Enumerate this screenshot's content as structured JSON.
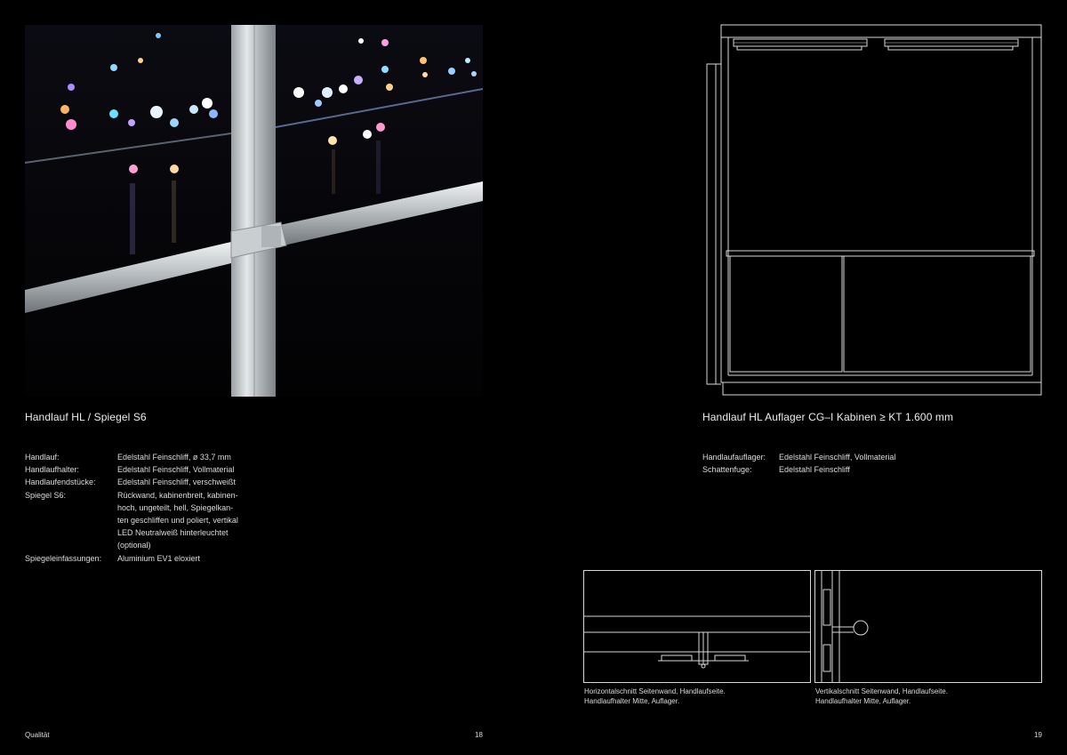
{
  "left_page": {
    "photo_alt": "Handlauf HL / Spiegel S6",
    "title": "Handlauf HL / Spiegel S6",
    "specs": [
      {
        "label": "Handlauf:",
        "value": "Edelstahl Feinschliff, ø 33,7 mm"
      },
      {
        "label": "Handlaufhalter:",
        "value": "Edelstahl Feinschliff, Vollmaterial"
      },
      {
        "label": "Handlaufendstücke:",
        "value": "Edelstahl Feinschliff, verschweißt"
      },
      {
        "label": "Spiegel S6:",
        "value_lines": [
          "Rückwand, kabinenbreit, kabinen-",
          "hoch, ungeteilt, hell, Spiegelkan-",
          "ten geschliffen und poliert, vertikal",
          "LED Neutralweiß hinterleuchtet",
          "(optional)"
        ]
      },
      {
        "label": "Spiegeleinfassungen:",
        "value": "Aluminium EV1 eloxiert"
      }
    ],
    "footer_section": "Qualität",
    "page_number": "18"
  },
  "right_page": {
    "title": "Handlauf HL Auflager CG–I Kabinen ≥ KT 1.600 mm",
    "specs": [
      {
        "label": "Handlaufauflager:",
        "value": "Edelstahl Feinschliff, Vollmaterial"
      },
      {
        "label": "Schattenfuge:",
        "value": "Edelstahl Feinschliff"
      }
    ],
    "caption_horizontal": [
      "Horizontalschnitt Seitenwand, Handlaufseite.",
      "Handlaufhalter Mitte, Auflager."
    ],
    "caption_vertical": [
      "Vertikalschnitt Seitenwand, Handlaufseite.",
      "Handlaufhalter Mitte, Auflager."
    ],
    "page_number": "19"
  },
  "colors": {
    "background": "#000000",
    "text": "#e6e6e6",
    "line": "#d8d8d8"
  }
}
